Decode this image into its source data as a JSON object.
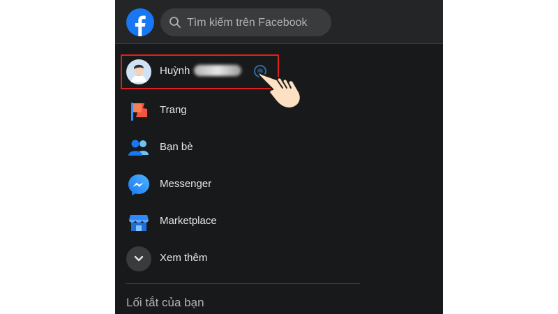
{
  "header": {
    "logo_icon": "facebook-logo-icon",
    "search": {
      "placeholder": "Tìm kiếm trên Facebook",
      "value": ""
    }
  },
  "sidebar": {
    "items": [
      {
        "label": "Huỳnh",
        "icon": "profile-avatar"
      },
      {
        "label": "Trang",
        "icon": "flag-icon"
      },
      {
        "label": "Bạn bè",
        "icon": "friends-icon"
      },
      {
        "label": "Messenger",
        "icon": "messenger-icon"
      },
      {
        "label": "Marketplace",
        "icon": "marketplace-shop-icon"
      },
      {
        "label": "Xem thêm",
        "icon": "chevron-down-icon"
      }
    ],
    "shortcuts_title": "Lối tắt của bạn"
  },
  "colors": {
    "panel_bg": "#18191a",
    "topbar_bg": "#242526",
    "text": "#e4e6eb",
    "secondary_text": "#b0b3b8",
    "brand_blue": "#1877f2",
    "highlight_red": "#e0201c"
  }
}
